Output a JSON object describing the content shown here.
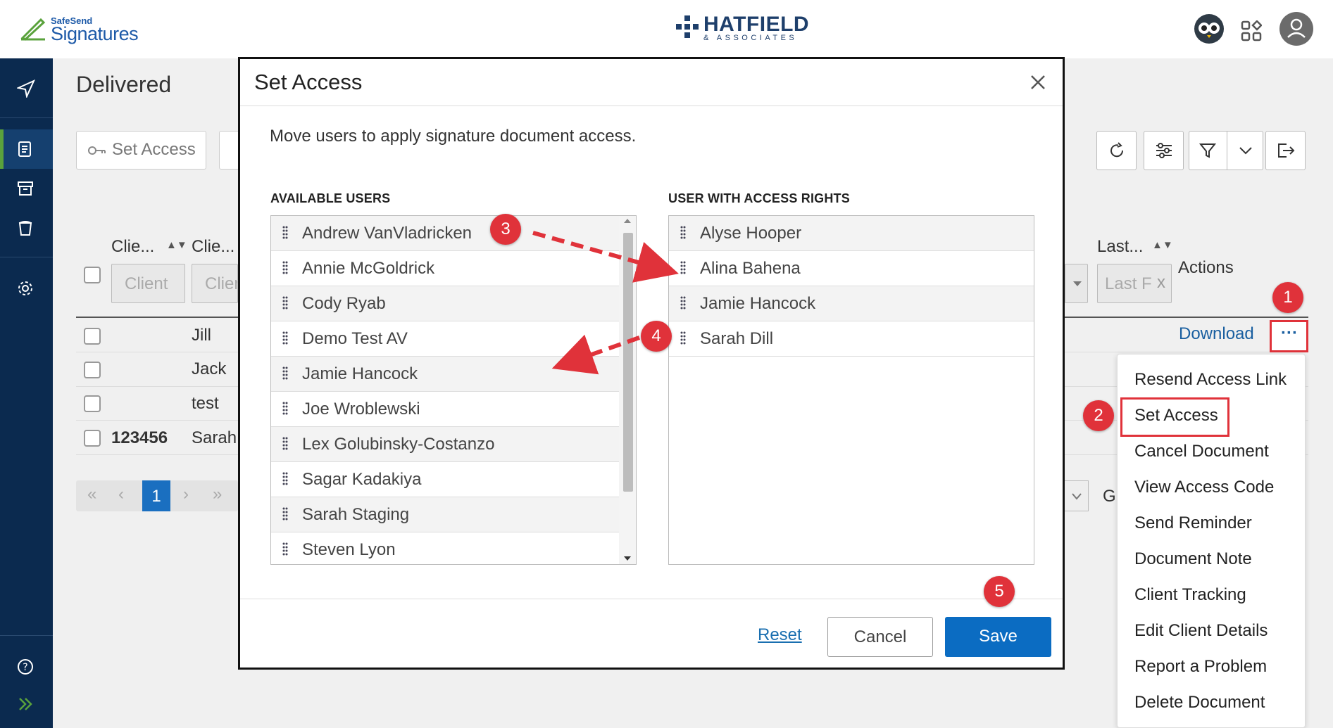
{
  "header": {
    "brand_small": "SafeSend",
    "brand_big": "Signatures",
    "firm_name": "HATFIELD",
    "firm_sub": "& ASSOCIATES"
  },
  "page": {
    "title": "Delivered",
    "set_access_label": "Set Access"
  },
  "table": {
    "headers": [
      "Clie...",
      "Clie...",
      "Last...",
      "Actions"
    ],
    "sort_glyph": "▲▼",
    "filters": [
      "Client",
      "Clier",
      "Last F"
    ],
    "filter_clear": "x",
    "rows": [
      {
        "col1": "",
        "col2": "Jill"
      },
      {
        "col1": "",
        "col2": "Jack"
      },
      {
        "col1": "",
        "col2": "test"
      },
      {
        "col1": "123456",
        "col2": "Sarah"
      }
    ],
    "download_label": "Download",
    "more_glyph": "···",
    "go_stub": "G"
  },
  "pager": {
    "first": "«",
    "prev": "‹",
    "current": "1",
    "next": "›",
    "last": "»"
  },
  "action_menu": {
    "items": [
      "Resend Access Link",
      "Set Access",
      "Cancel Document",
      "View Access Code",
      "Send Reminder",
      "Document Note",
      "Client Tracking",
      "Edit Client Details",
      "Report a Problem",
      "Delete Document"
    ]
  },
  "dialog": {
    "title": "Set Access",
    "description": "Move users to apply signature document access.",
    "available_label": "AVAILABLE USERS",
    "access_label": "USER WITH ACCESS RIGHTS",
    "available_users": [
      "Andrew VanVladricken",
      "Annie McGoldrick",
      "Cody Ryab",
      "Demo Test AV",
      "Jamie Hancock",
      "Joe Wroblewski",
      "Lex Golubinsky-Costanzo",
      "Sagar Kadakiya",
      "Sarah Staging",
      "Steven Lyon"
    ],
    "access_users": [
      "Alyse Hooper",
      "Alina Bahena",
      "Jamie Hancock",
      "Sarah Dill"
    ],
    "reset_label": "Reset",
    "cancel_label": "Cancel",
    "save_label": "Save"
  },
  "annotations": [
    "1",
    "2",
    "3",
    "4",
    "5"
  ],
  "colors": {
    "sidebar": "#0b2a4f",
    "accent": "#0b6cc2",
    "annotation_red": "#e0323a",
    "active_indicator": "#5aa23c"
  }
}
